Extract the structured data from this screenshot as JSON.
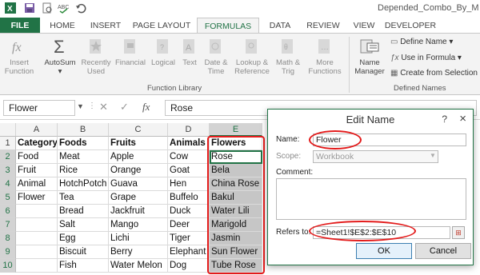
{
  "title_bar": {
    "document_title": "Depended_Combo_By_M"
  },
  "tabs": [
    "FILE",
    "HOME",
    "INSERT",
    "PAGE LAYOUT",
    "FORMULAS",
    "DATA",
    "REVIEW",
    "VIEW",
    "DEVELOPER"
  ],
  "ribbon": {
    "insert_function": [
      "Insert",
      "Function"
    ],
    "autosum": "AutoSum",
    "recently_used": [
      "Recently",
      "Used"
    ],
    "financial": "Financial",
    "logical": "Logical",
    "text": "Text",
    "date_time": [
      "Date &",
      "Time"
    ],
    "lookup_reference": [
      "Lookup &",
      "Reference"
    ],
    "math_trig": [
      "Math &",
      "Trig"
    ],
    "more_functions": [
      "More",
      "Functions"
    ],
    "function_library_label": "Function Library",
    "name_manager": [
      "Name",
      "Manager"
    ],
    "define_name": "Define Name",
    "use_in_formula": "Use in Formula",
    "create_from_selection": "Create from Selection",
    "defined_names_label": "Defined Names"
  },
  "formula_bar": {
    "name_box": "Flower",
    "fx_symbol": "fx",
    "formula": "Rose"
  },
  "grid": {
    "columns": [
      "A",
      "B",
      "C",
      "D",
      "E"
    ],
    "rows": [
      [
        "Category",
        "Foods",
        "Fruits",
        "Animals",
        "Flowers"
      ],
      [
        "Food",
        "Meat",
        "Apple",
        "Cow",
        "Rose"
      ],
      [
        "Fruit",
        "Rice",
        "Orange",
        "Goat",
        "Bela"
      ],
      [
        "Animal",
        "HotchPotch",
        "Guava",
        "Hen",
        "China Rose"
      ],
      [
        "Flower",
        "Tea",
        "Grape",
        "Buffelo",
        "Bakul"
      ],
      [
        "",
        "Bread",
        "Jackfruit",
        "Duck",
        "Water Lili"
      ],
      [
        "",
        "Salt",
        "Mango",
        "Deer",
        "Marigold"
      ],
      [
        "",
        "Egg",
        "Lichi",
        "Tiger",
        "Jasmin"
      ],
      [
        "",
        "Biscuit",
        "Berry",
        "Elephant",
        "Sun Flower"
      ],
      [
        "",
        "Fish",
        "Water Melon",
        "Dog",
        "Tube Rose"
      ]
    ]
  },
  "dialog": {
    "title": "Edit Name",
    "help": "?",
    "close": "×",
    "name_label": "Name:",
    "name_value": "Flower",
    "scope_label": "Scope:",
    "scope_value": "Workbook",
    "comment_label": "Comment:",
    "refers_label": "Refers to:",
    "refers_value": "=Sheet1!$E$2:$E$10",
    "ok": "OK",
    "cancel": "Cancel"
  },
  "colors": {
    "accent": "#217346",
    "highlight": "#e31b1b"
  }
}
